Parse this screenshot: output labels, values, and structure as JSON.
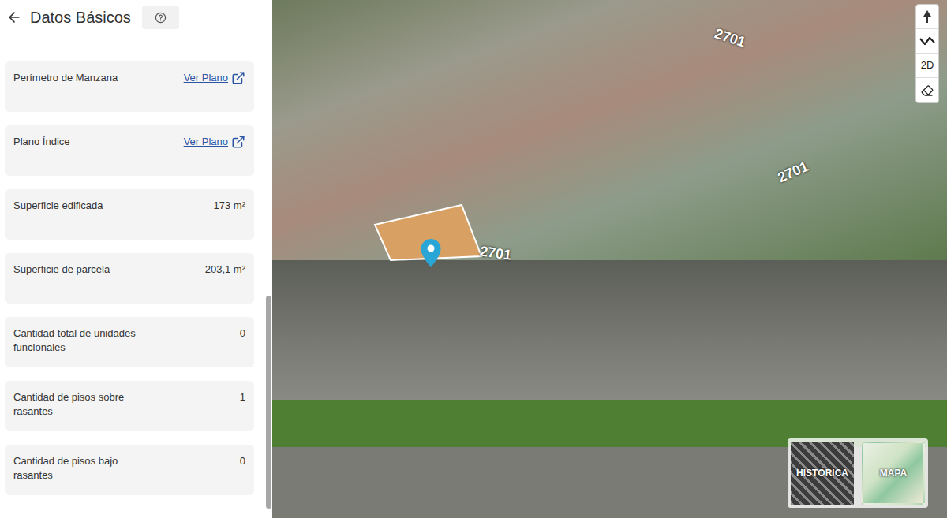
{
  "header": {
    "title": "Datos Básicos"
  },
  "cards": [
    {
      "label": "Perímetro de Manzana",
      "value": "Ver Plano",
      "kind": "link"
    },
    {
      "label": "Plano Índice",
      "value": "Ver Plano",
      "kind": "link"
    },
    {
      "label": "Superficie edificada",
      "value": "173 m²",
      "kind": "text"
    },
    {
      "label": "Superficie de parcela",
      "value": "203,1 m²",
      "kind": "text"
    },
    {
      "label": "Cantidad total de unidades funcionales",
      "value": "0",
      "kind": "text"
    },
    {
      "label": "Cantidad de pisos sobre rasantes",
      "value": "1",
      "kind": "text"
    },
    {
      "label": "Cantidad de pisos bajo rasantes",
      "value": "0",
      "kind": "text"
    }
  ],
  "map": {
    "labels": [
      "2701",
      "2701",
      "2701"
    ],
    "view_toggle": "2D",
    "layers": [
      {
        "label": "HISTÓRICA",
        "selected": false
      },
      {
        "label": "MAPA",
        "selected": false
      }
    ]
  }
}
